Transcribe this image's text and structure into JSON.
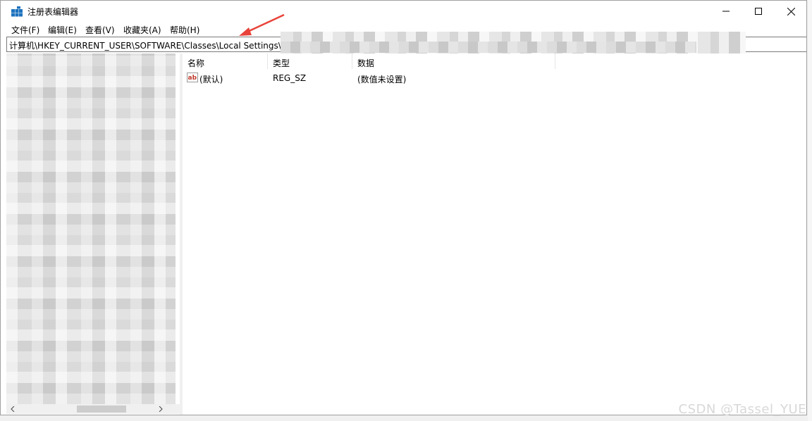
{
  "window": {
    "title": "注册表编辑器"
  },
  "menu": [
    "文件(F)",
    "编辑(E)",
    "查看(V)",
    "收藏夹(A)",
    "帮助(H)"
  ],
  "address": {
    "path": "计算机\\HKEY_CURRENT_USER\\SOFTWARE\\Classes\\Local Settings\\S"
  },
  "list": {
    "columns": [
      "名称",
      "类型",
      "数据"
    ],
    "rows": [
      {
        "name": "(默认)",
        "type": "REG_SZ",
        "data": "(数值未设置)",
        "icon": "string-value-icon"
      }
    ]
  },
  "icons": {
    "app": "registry-editor-icon",
    "minimize": "minimize-icon",
    "maximize": "maximize-icon",
    "close": "close-icon"
  },
  "colors": {
    "arrow": "#e8433a",
    "accent": "#1e73be"
  },
  "watermark": "CSDN @Tassel_YUE"
}
